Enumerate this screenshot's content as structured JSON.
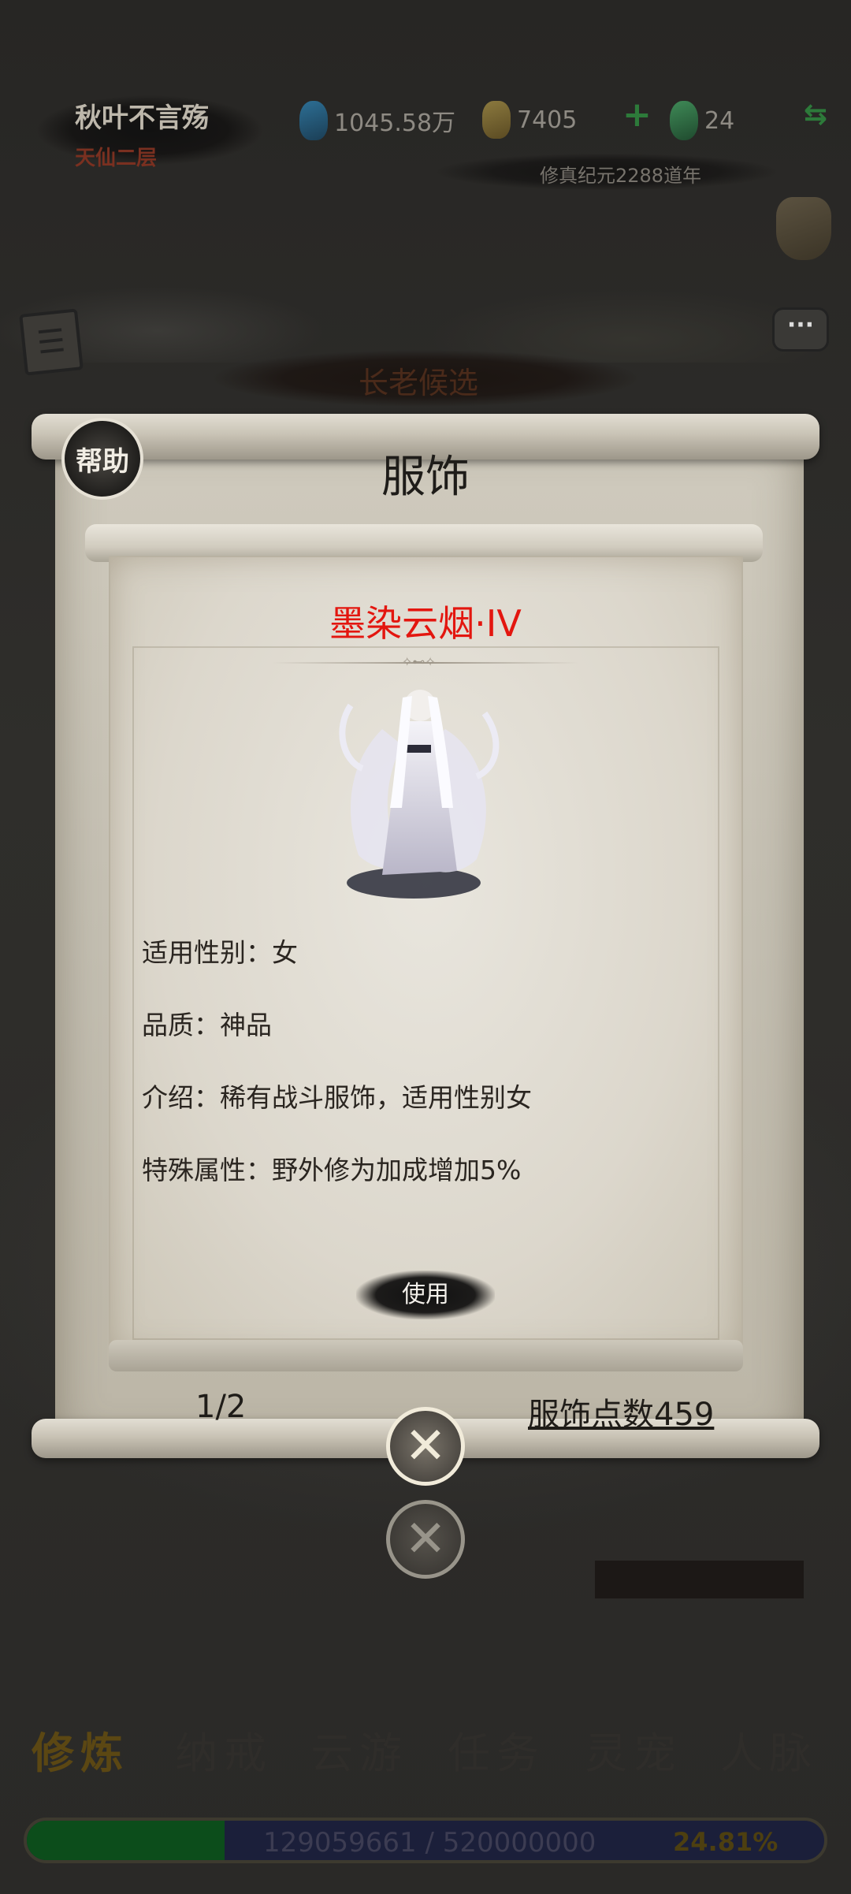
{
  "player": {
    "name": "秋叶不言殇",
    "realm": "天仙二层"
  },
  "resources": {
    "spirit_stones": "1045.58万",
    "gold": "7405",
    "jade": "24"
  },
  "era": "修真纪元2288道年",
  "background": {
    "elder_banner": "长老候选",
    "tabs": [
      "修炼",
      "纳戒",
      "云游",
      "任务",
      "灵宠",
      "人脉"
    ],
    "active_tab_index": 0,
    "exp": {
      "text": "129059661 / 520000000",
      "percent_text": "24.81%",
      "fill_fraction": 0.248
    }
  },
  "dialog": {
    "help_label": "帮助",
    "title": "服饰",
    "item_name": "墨染云烟·IV",
    "item_name_color": "#e3160f",
    "attributes": [
      {
        "label": "适用性别：",
        "value": "女"
      },
      {
        "label": "品质：",
        "value": "神品"
      },
      {
        "label": "介绍：",
        "value": "稀有战斗服饰，适用性别女"
      },
      {
        "label": "特殊属性：",
        "value": "野外修为加成增加5%"
      }
    ],
    "use_label": "使用",
    "page_indicator": "1/2",
    "points_label": "服饰点数459"
  },
  "icons": {
    "gem": "spirit-stone-icon",
    "coin": "gold-coin-icon",
    "jade": "jade-icon",
    "close": "close-icon"
  }
}
